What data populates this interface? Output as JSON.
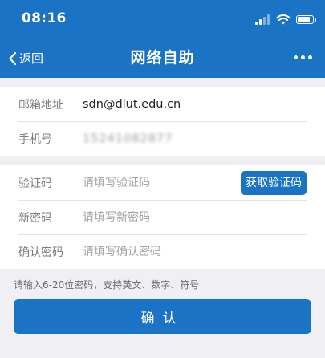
{
  "status_bar": {
    "time": "08:16",
    "icons": [
      "signal-icon",
      "wifi-icon",
      "battery-icon"
    ]
  },
  "nav": {
    "back_label": "返回",
    "title": "网络自助",
    "more_icon": "more-icon"
  },
  "account": {
    "email_label": "邮箱地址",
    "email_value": "sdn@dlut.edu.cn",
    "phone_label": "手机号",
    "phone_value": "15241082877"
  },
  "form": {
    "code_label": "验证码",
    "code_placeholder": "请填写验证码",
    "get_code_label": "获取验证码",
    "new_password_label": "新密码",
    "new_password_placeholder": "请填写新密码",
    "confirm_password_label": "确认密码",
    "confirm_password_placeholder": "请填写确认密码"
  },
  "hint": "请输入6-20位密码，支持英文、数字、符号",
  "confirm_label": "确认",
  "colors": {
    "primary": "#1a73c4",
    "background": "#efeff4"
  }
}
